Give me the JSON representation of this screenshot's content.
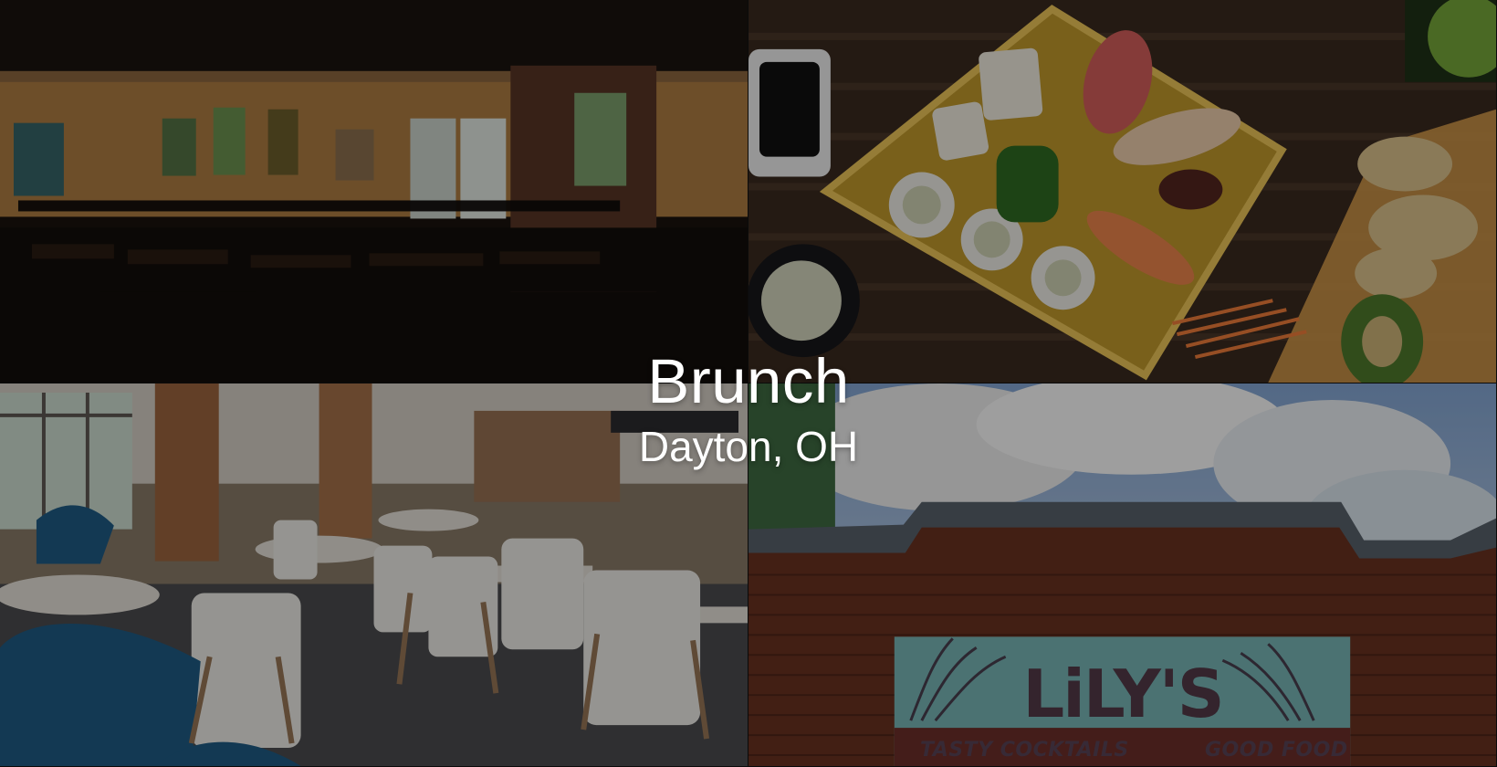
{
  "hero": {
    "title": "Brunch",
    "subtitle": "Dayton, OH"
  },
  "tiles": {
    "sign": {
      "brand": "LiLY'S",
      "left_tagline": "TASTY COCKTAILS",
      "right_tagline": "GOOD FOOD"
    }
  },
  "colors": {
    "overlay": "rgba(0,0,0,0.38)",
    "text": "#ffffff",
    "sign_bg": "#79b8b8"
  }
}
